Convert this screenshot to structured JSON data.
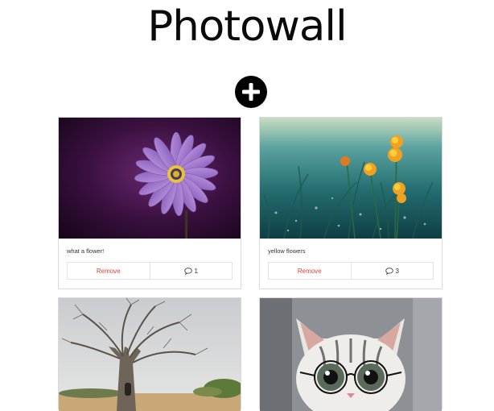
{
  "header": {
    "title": "Photowall"
  },
  "add_button": {
    "icon": "plus-icon",
    "background": "#000000"
  },
  "posts": [
    {
      "caption": "what a flower!",
      "remove_label": "Remove",
      "comment_count": "1",
      "comment_icon": "comment-icon",
      "image": "purple daisy flower on dark purple background"
    },
    {
      "caption": "yellow flowers",
      "remove_label": "Remove",
      "comment_count": "3",
      "comment_icon": "comment-icon",
      "image": "yellow flowers in dewy grass"
    },
    {
      "image": "baobab tree in savanna"
    },
    {
      "image": "white tabby kitten wearing round glasses"
    }
  ],
  "colors": {
    "remove": "#e0443a",
    "border": "#d9d9d9"
  }
}
